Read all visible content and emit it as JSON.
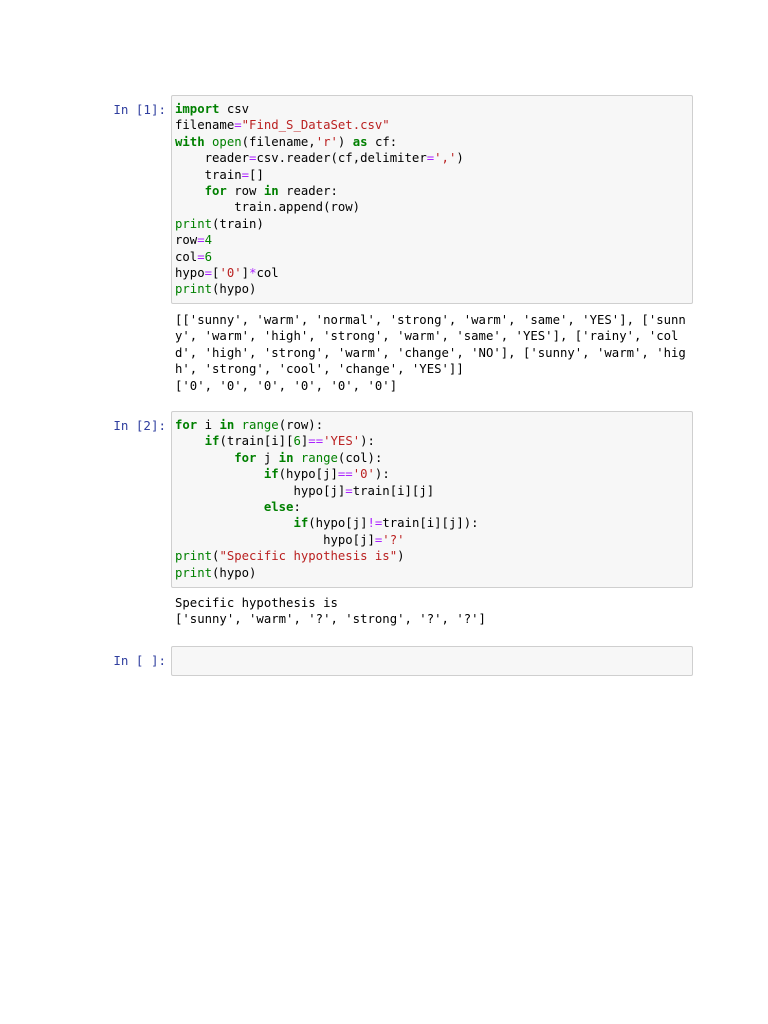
{
  "colors": {
    "prompt": "#303f9f",
    "keyword": "#008000",
    "string": "#ba2121",
    "operator": "#aa22ff",
    "cell_border": "#cfcfcf",
    "cell_background": "#f7f7f7"
  },
  "cells": [
    {
      "prompt": "In [1]:",
      "code_lines": [
        "import csv",
        "filename=\"Find_S_DataSet.csv\"",
        "with open(filename,'r') as cf:",
        "    reader=csv.reader(cf,delimiter=',')",
        "    train=[]",
        "    for row in reader:",
        "        train.append(row)",
        "print(train)",
        "row=4",
        "col=6",
        "hypo=['0']*col",
        "print(hypo)"
      ],
      "output_lines": [
        "[['sunny', 'warm', 'normal', 'strong', 'warm', 'same', 'YES'], ['sunn",
        "y', 'warm', 'high', 'strong', 'warm', 'same', 'YES'], ['rainy', 'col",
        "d', 'high', 'strong', 'warm', 'change', 'NO'], ['sunny', 'warm', 'hig",
        "h', 'strong', 'cool', 'change', 'YES']]",
        "['0', '0', '0', '0', '0', '0']"
      ]
    },
    {
      "prompt": "In [2]:",
      "code_lines": [
        "for i in range(row):",
        "    if(train[i][6]=='YES'):",
        "        for j in range(col):",
        "            if(hypo[j]=='0'):",
        "                hypo[j]=train[i][j]",
        "            else:",
        "                if(hypo[j]!=train[i][j]):",
        "                    hypo[j]='?'",
        "print(\"Specific hypothesis is\")",
        "print(hypo)"
      ],
      "output_lines": [
        "Specific hypothesis is",
        "['sunny', 'warm', '?', 'strong', '?', '?']"
      ]
    },
    {
      "prompt": "In [ ]:",
      "code_lines": [],
      "output_lines": []
    }
  ]
}
